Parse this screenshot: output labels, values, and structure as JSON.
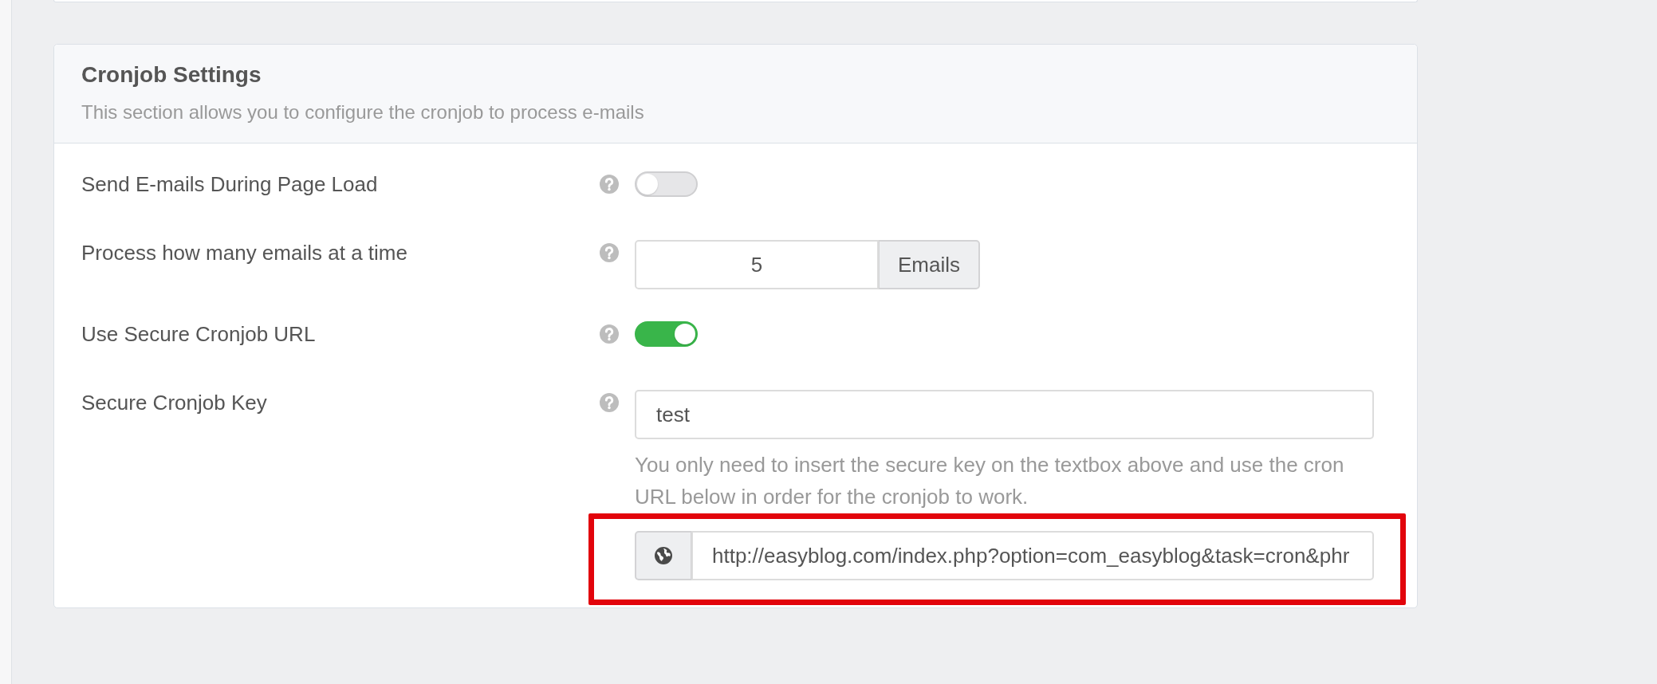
{
  "section": {
    "title": "Cronjob Settings",
    "description": "This section allows you to configure the cronjob to process e-mails"
  },
  "settings": [
    {
      "kind": "toggle",
      "label": "Send E-mails During Page Load",
      "on": false
    },
    {
      "kind": "number",
      "label": "Process how many emails at a time",
      "value": "5",
      "unit": "Emails"
    },
    {
      "kind": "toggle",
      "label": "Use Secure Cronjob URL",
      "on": true
    },
    {
      "kind": "text",
      "label": "Secure Cronjob Key",
      "value": "test",
      "hint": "You only need to insert the secure key on the textbox above and use the cron URL below in order for the cronjob to work.",
      "cron_url": {
        "value": "http://easyblog.com/index.php?option=com_easyblog&task=cron&phr",
        "highlighted": true
      }
    }
  ]
}
